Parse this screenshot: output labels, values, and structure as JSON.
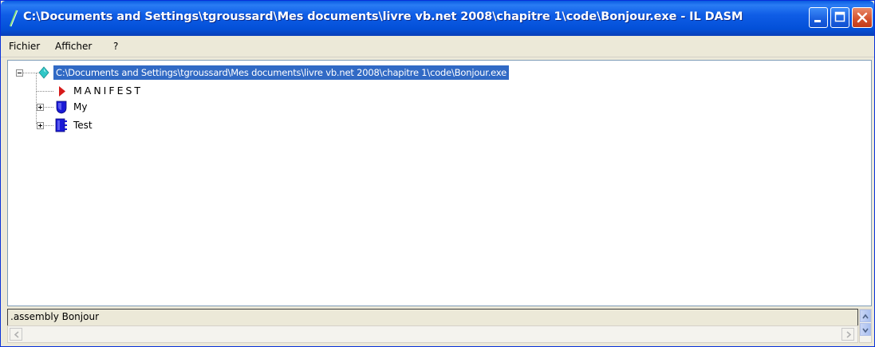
{
  "window": {
    "title": "C:\\Documents and Settings\\tgroussard\\Mes documents\\livre vb.net 2008\\chapitre 1\\code\\Bonjour.exe - IL DASM"
  },
  "menu": {
    "items": [
      "Fichier",
      "Afficher",
      "?"
    ]
  },
  "tree": {
    "root_label": "C:\\Documents and Settings\\tgroussard\\Mes documents\\livre vb.net 2008\\chapitre 1\\code\\Bonjour.exe",
    "children": [
      {
        "label": "MANIFEST",
        "icon": "manifest-arrow-icon"
      },
      {
        "label": "My",
        "icon": "namespace-shield-icon"
      },
      {
        "label": "Test",
        "icon": "class-icon"
      }
    ]
  },
  "info_pane": {
    "text": ".assembly Bonjour"
  },
  "colors": {
    "titlebar": "#0350d8",
    "selection": "#316ac5",
    "manifest_icon": "#d61a1a",
    "type_icon": "#1a1ad6",
    "root_icon": "#2fc7c7"
  }
}
